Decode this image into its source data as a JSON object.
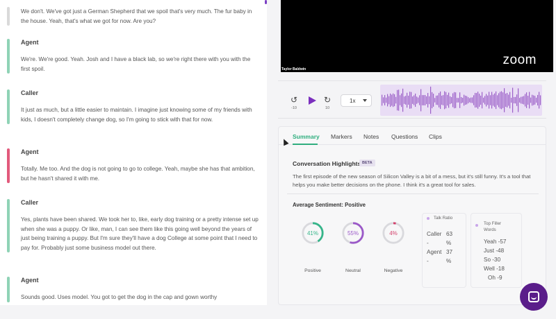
{
  "transcript": {
    "messages": [
      {
        "speaker": "",
        "text": "We don't. We've got just a German Shepherd that we spoil that's very much. The fur baby in the house. Yeah, that's what we got for now. Are you?"
      },
      {
        "speaker": "Agent",
        "text": "We're. We're good. Yeah. Josh and I have a black lab, so we're right there with you with the first spoil."
      },
      {
        "speaker": "Caller",
        "text": "It just as much, but a little easier to maintain. I imagine just knowing some of my friends with kids, I doesn't completely change dog, so I'm going to stick with that for now."
      },
      {
        "speaker": "Agent",
        "text": "Totally. Me too. And the dog is not going to go to college. Yeah, maybe she has that ambition, but he hasn't shared it with me."
      },
      {
        "speaker": "Caller",
        "text": "Yes, plants have been shared. We took her to, like, early dog training or a pretty intense set up when she was a puppy. Or like, man, I can see them like this going well beyond the years of just being training a puppy. But I'm sure they'll have a dog College at some point that I need to pay for. Probably just some business model out there."
      },
      {
        "speaker": "Agent",
        "text": "Sounds good. Uses model. You got to get the dog in the cap and gown worthy"
      }
    ]
  },
  "video": {
    "brand": "zoom",
    "participant_name": "Taylor Baldwin"
  },
  "player": {
    "rewind_seconds": "-10",
    "forward_seconds": "10",
    "speed": "1x"
  },
  "tabs": [
    "Summary",
    "Markers",
    "Notes",
    "Questions",
    "Clips"
  ],
  "highlights": {
    "title": "Conversation Highlights",
    "badge": "BETA",
    "text": "The first episode of the new season of Silicon Valley is a bit of a mess, but it's still funny. It's a tool that helps you make better decisions on the phone. I think it's a great tool for sales."
  },
  "sentiment": {
    "title": "Average Sentiment: Positive",
    "gauges": [
      {
        "label": "Positive",
        "value": 41,
        "display": "41%",
        "color": "#36b58a"
      },
      {
        "label": "Neutral",
        "value": 55,
        "display": "55%",
        "color": "#9b59c8"
      },
      {
        "label": "Negative",
        "value": 4,
        "display": "4%",
        "color": "#d23f6a"
      }
    ]
  },
  "talk_ratio": {
    "title": "Talk Ratio",
    "rows": [
      {
        "label": "Caller",
        "value": "63"
      },
      {
        "label": "-",
        "value": "%"
      },
      {
        "label": "Agent",
        "value": "37"
      },
      {
        "label": "-",
        "value": "%"
      }
    ]
  },
  "filler_words": {
    "title_line1": "Top Filler",
    "title_line2": "Words",
    "rows": [
      {
        "word": "Yeah",
        "count": "-57"
      },
      {
        "word": "Just",
        "count": "-48"
      },
      {
        "word": "So",
        "count": "-30"
      },
      {
        "word": "Well",
        "count": "-18"
      },
      {
        "word": "Oh",
        "count": "-9"
      }
    ]
  },
  "colors": {
    "accent": "#7b2fbe",
    "tab_active": "#2fae7e",
    "agent_bar": "#8fd3b6",
    "negative_bar": "#e25a7c"
  }
}
